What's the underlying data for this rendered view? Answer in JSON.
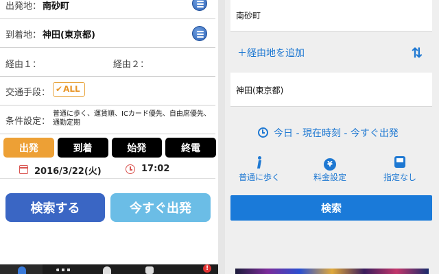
{
  "left": {
    "departure": {
      "label": "出発地：",
      "value": "南砂町"
    },
    "arrival": {
      "label": "到着地：",
      "value": "神田(東京都)"
    },
    "via1": {
      "label": "経由１："
    },
    "via2": {
      "label": "経由２："
    },
    "transport": {
      "label": "交通手段：",
      "badge": "ALL",
      "check": "✔"
    },
    "conditions": {
      "label": "条件設定：",
      "value": "普通に歩く、運賃順、ICカード優先、自由席優先、通勤定期"
    },
    "modes": [
      "出発",
      "到着",
      "始発",
      "終電"
    ],
    "active_mode": "出発",
    "date": "2016/3/22(火)",
    "time": "17:02",
    "search_button": "検索する",
    "depart_now_button": "今すぐ出発",
    "alert_badge": "!"
  },
  "right": {
    "departure": "南砂町",
    "add_via": "＋経由地を追加",
    "arrival": "神田(東京都)",
    "when": "今日 - 現在時刻 - 今すぐ出発",
    "options": [
      {
        "label": "普通に歩く",
        "icon": "walk-icon"
      },
      {
        "label": "料金設定",
        "icon": "yen-icon",
        "glyph": "¥"
      },
      {
        "label": "指定なし",
        "icon": "bus-icon"
      }
    ],
    "search_button": "検索"
  },
  "colors": {
    "orange": "#eda035",
    "blue_primary": "#3a66c4",
    "blue_light": "#6bbde6",
    "link_blue": "#1e78d2"
  }
}
